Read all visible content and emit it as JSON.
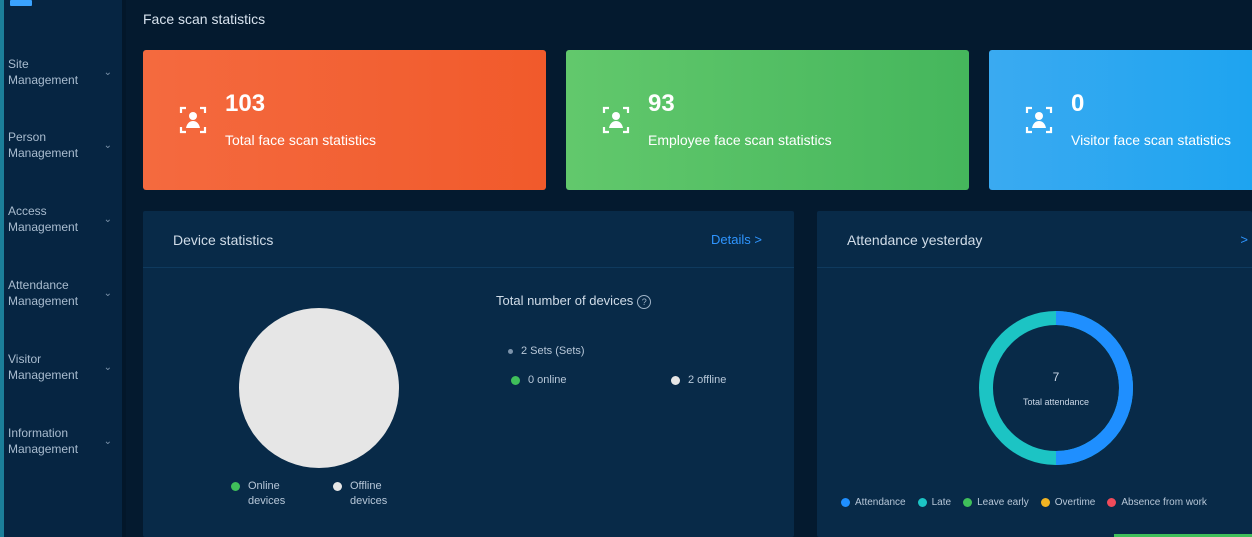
{
  "colors": {
    "background": "#041a2f",
    "sidebar": "#062542",
    "panel": "#082a48",
    "orange": "#f15a2b",
    "green": "#45b65c",
    "blue": "#1ea4f0",
    "link": "#2f95ff",
    "pie_fill": "#e6e6e6",
    "online": "#3fbf5a",
    "offline": "#e6e6e6",
    "attendance": "#1f8fff",
    "late": "#1cc4c4",
    "leave_early": "#3fbf5a",
    "overtime": "#f0b323",
    "absence": "#ef4b5a"
  },
  "sidebar": {
    "items": [
      {
        "label": "Site Management",
        "icon": "chevron-down-icon"
      },
      {
        "label": "Person Management",
        "icon": "chevron-down-icon"
      },
      {
        "label": "Access Management",
        "icon": "chevron-down-icon"
      },
      {
        "label": "Attendance Management",
        "icon": "chevron-down-icon"
      },
      {
        "label": "Visitor Management",
        "icon": "chevron-down-icon"
      },
      {
        "label": "Information Management",
        "icon": "chevron-down-icon"
      }
    ]
  },
  "header": {
    "title": "Face scan statistics"
  },
  "cards": [
    {
      "value": "103",
      "label": "Total face scan statistics",
      "icon": "person-scan-icon"
    },
    {
      "value": "93",
      "label": "Employee face scan statistics",
      "icon": "person-scan-icon"
    },
    {
      "value": "0",
      "label": "Visitor face scan statistics",
      "icon": "person-scan-icon"
    }
  ],
  "device_panel": {
    "title": "Device statistics",
    "link": "Details >",
    "total_label": "Total number of devices",
    "total_count": "2 Sets (Sets)",
    "online": "0 online",
    "offline": "2 offline",
    "legend_online": "Online devices",
    "legend_offline": "Offline devices",
    "online_count": 0,
    "offline_count": 2
  },
  "attendance_panel": {
    "title": "Attendance yesterday",
    "link": ">",
    "center_value": "7",
    "center_label": "Total attendance",
    "legend": [
      "Attendance",
      "Late",
      "Leave early",
      "Overtime",
      "Absence from work"
    ],
    "values": [
      3.5,
      3.5,
      0,
      0,
      0
    ]
  }
}
